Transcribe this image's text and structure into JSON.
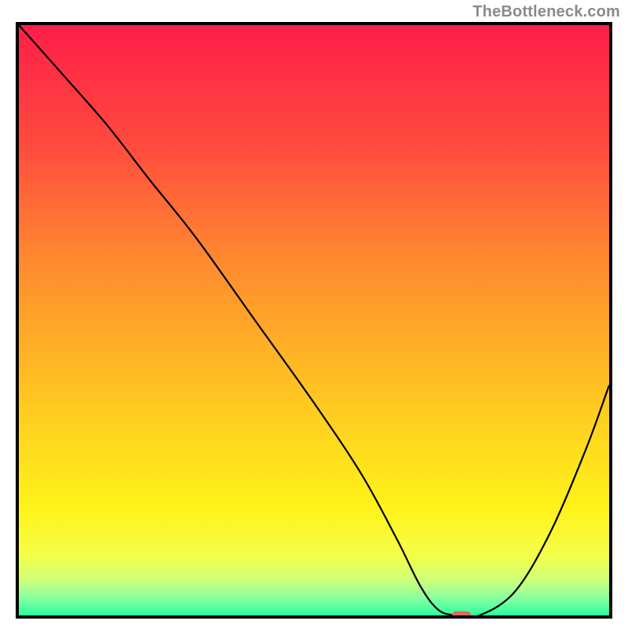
{
  "watermark": "TheBottleneck.com",
  "chart_data": {
    "type": "line",
    "title": "",
    "xlabel": "",
    "ylabel": "",
    "xlim": [
      0,
      100
    ],
    "ylim": [
      0,
      100
    ],
    "grid": false,
    "legend": false,
    "background": {
      "description": "Vertical gradient from red at top through orange and yellow to green at bottom",
      "stops": [
        {
          "pos": 0.0,
          "color": "#ff1e49"
        },
        {
          "pos": 0.2,
          "color": "#ff4a3e"
        },
        {
          "pos": 0.4,
          "color": "#ff8a2f"
        },
        {
          "pos": 0.55,
          "color": "#ffb126"
        },
        {
          "pos": 0.7,
          "color": "#ffd81e"
        },
        {
          "pos": 0.82,
          "color": "#fff31a"
        },
        {
          "pos": 0.9,
          "color": "#f3ff4a"
        },
        {
          "pos": 0.94,
          "color": "#cfff7a"
        },
        {
          "pos": 0.97,
          "color": "#8affa0"
        },
        {
          "pos": 1.0,
          "color": "#2aff9f"
        }
      ]
    },
    "series": [
      {
        "name": "bottleneck-curve",
        "color": "#000000",
        "x": [
          0,
          8,
          15,
          22,
          30,
          40,
          50,
          58,
          64,
          68,
          71,
          74,
          78,
          84,
          90,
          96,
          100
        ],
        "values": [
          100,
          91,
          83,
          74,
          64,
          50,
          36,
          24,
          13,
          5,
          1,
          0,
          0,
          4,
          14,
          28,
          39
        ]
      }
    ],
    "marker": {
      "shape": "rounded-rect",
      "color": "#e0685f",
      "x": 75,
      "y": 0,
      "width_pct": 3.2,
      "height_pct": 1.4
    }
  }
}
